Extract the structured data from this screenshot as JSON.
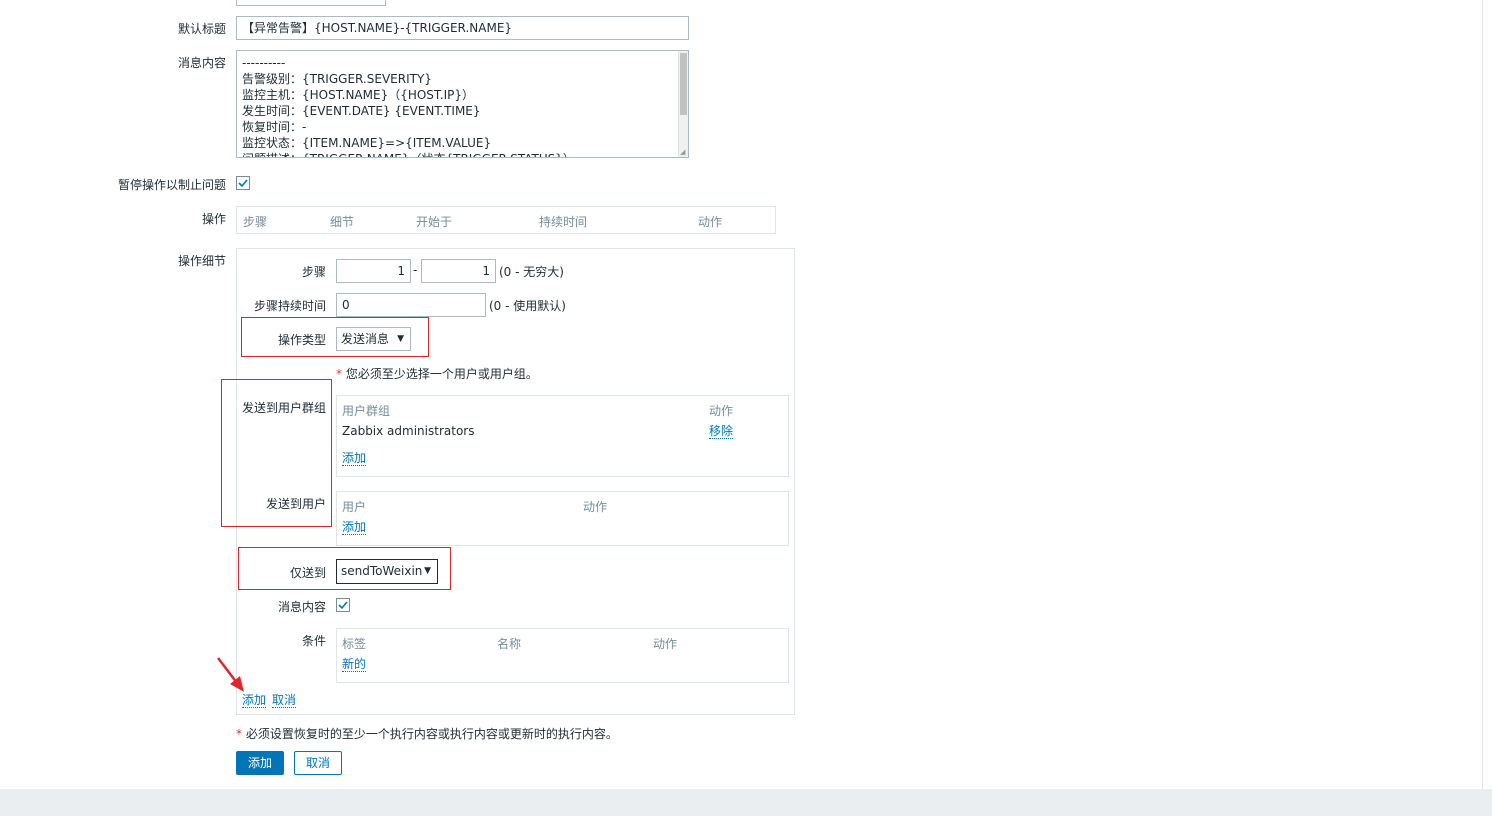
{
  "form": {
    "default_subject_label": "默认标题",
    "default_subject_value": "【异常告警】{HOST.NAME}-{TRIGGER.NAME}",
    "default_message_label": "消息内容",
    "default_message_lines": [
      "----------",
      "告警级别：{TRIGGER.SEVERITY}",
      "监控主机：{HOST.NAME}（{HOST.IP}）",
      "发生时间：{EVENT.DATE} {EVENT.TIME}",
      "恢复时间：-",
      "监控状态：{ITEM.NAME}=>{ITEM.VALUE}",
      "问题描述：{TRIGGER.NAME}（状态{TRIGGER.STATUS}）"
    ],
    "pause_label": "暂停操作以制止问题",
    "operations_label": "操作",
    "operations_headers": [
      "步骤",
      "细节",
      "开始于",
      "持续时间",
      "动作"
    ],
    "details_label": "操作细节"
  },
  "details": {
    "steps_label": "步骤",
    "step_from": "1",
    "step_dash": "-",
    "step_to": "1",
    "steps_hint": "(0 - 无穷大)",
    "step_duration_label": "步骤持续时间",
    "step_duration_value": "0",
    "step_duration_hint": "(0 - 使用默认)",
    "op_type_label": "操作类型",
    "op_type_value": "发送消息",
    "required_star": "*",
    "required_text": "您必须至少选择一个用户或用户组。",
    "send_groups_label": "发送到用户群组",
    "groups_col_group": "用户群组",
    "groups_col_action": "动作",
    "group_row_name": "Zabbix administrators",
    "group_row_remove": "移除",
    "groups_add": "添加",
    "send_users_label": "发送到用户",
    "users_col_user": "用户",
    "users_col_action": "动作",
    "users_add": "添加",
    "send_only_label": "仅送到",
    "send_only_value": "sendToWeixin",
    "message_label": "消息内容",
    "conditions_label": "条件",
    "cond_col_label": "标签",
    "cond_col_name": "名称",
    "cond_col_action": "动作",
    "cond_new": "新的",
    "add_link": "添加",
    "cancel_link": "取消"
  },
  "footer": {
    "star": "*",
    "note": "必须设置恢复时的至少一个执行内容或执行内容或更新时的执行内容。",
    "add_button": "添加",
    "cancel_button": "取消"
  },
  "colors": {
    "link": "#0275b8",
    "annotation_red": "#d5262e",
    "primary_button": "#0275b8"
  },
  "icons": {
    "checkbox": "checkmark-icon",
    "dropdown": "triangle-down-icon",
    "annotation_arrow": "red-arrow-icon"
  }
}
